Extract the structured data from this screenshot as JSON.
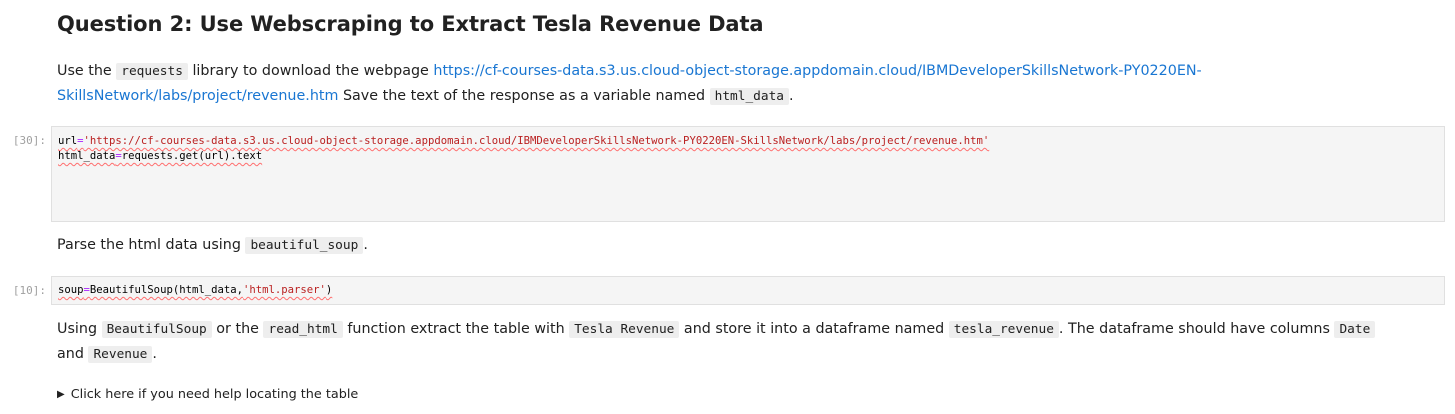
{
  "heading": "Question 2: Use Webscraping to Extract Tesla Revenue Data",
  "para1": {
    "t1": "Use the ",
    "code1": "requests",
    "t2": " library to download the webpage ",
    "link": "https://cf-courses-data.s3.us.cloud-object-storage.appdomain.cloud/IBMDeveloperSkillsNetwork-PY0220EN-SkillsNetwork/labs/project/revenue.htm",
    "link_line1": "https://cf-courses-data.s3.us.cloud-object-storage.appdomain.cloud/IBMDeveloperSkillsNetwork-PY0220EN-",
    "link_line2": "SkillsNetwork/labs/project/revenue.htm",
    "t3": " Save the text of the response as a variable named ",
    "code2": "html_data",
    "t4": "."
  },
  "cell1": {
    "prompt": "[30]:",
    "line1_var": "url",
    "line1_eq": "=",
    "line1_str": "'https://cf-courses-data.s3.us.cloud-object-storage.appdomain.cloud/IBMDeveloperSkillsNetwork-PY0220EN-SkillsNetwork/labs/project/revenue.htm'",
    "line2_var": "html_data",
    "line2_eq": "=",
    "line2_rest": "requests.get(url).text"
  },
  "para2": {
    "t1": "Parse the html data using ",
    "code1": "beautiful_soup",
    "t2": "."
  },
  "cell2": {
    "prompt": "[10]:",
    "var": "soup",
    "eq": "=",
    "call": "BeautifulSoup(html_data,",
    "str": "'html.parser'",
    "close": ")"
  },
  "para3": {
    "t1": "Using ",
    "code1": "BeautifulSoup",
    "t2": " or the ",
    "code2": "read_html",
    "t3": " function extract the table with ",
    "code3": "Tesla Revenue",
    "t4": " and store it into a dataframe named ",
    "code4": "tesla_revenue",
    "t5": ". The dataframe should have columns ",
    "code5": "Date",
    "t6": "and ",
    "code6": "Revenue",
    "t7": "."
  },
  "details": {
    "icon": "disclosure-triangle-icon",
    "summary": "Click here if you need help locating the table"
  }
}
